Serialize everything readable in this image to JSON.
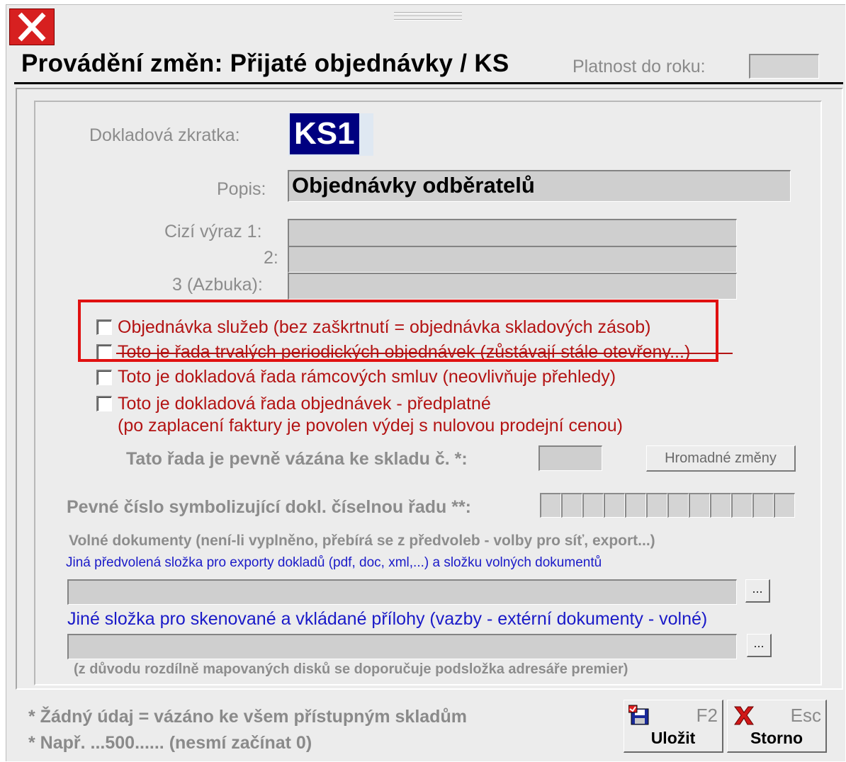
{
  "window": {
    "title": "Provádění změn: Přijaté objednávky / KS",
    "platnost_label": "Platnost do roku:",
    "platnost_value": ""
  },
  "form": {
    "dokladova_zkratka_label": "Dokladová zkratka:",
    "dokladova_zkratka_value": "KS1",
    "popis_label": "Popis:",
    "popis_value": "Objednávky odběratelů",
    "cizi_vyraz_1_label": "Cizí výraz 1:",
    "cizi_vyraz_2_label": "2:",
    "cizi_vyraz_3_label": "3 (Azbuka):",
    "cizi_vyraz_1_value": "",
    "cizi_vyraz_2_value": "",
    "cizi_vyraz_3_value": ""
  },
  "checkboxes": [
    {
      "label": "Objednávka služeb (bez zaškrtnutí = objednávka skladových zásob)",
      "checked": false
    },
    {
      "label": "Toto je řada trvalých periodických objednávek (zůstávají stále otevřeny...)",
      "checked": false
    },
    {
      "label": "Toto je dokladová řada rámcových smluv (neovlivňuje přehledy)",
      "checked": false
    },
    {
      "label": "Toto je dokladová řada objednávek - předplatné",
      "label_line2": "(po zaplacení faktury je povolen výdej s nulovou prodejní cenou)",
      "checked": false
    }
  ],
  "sklad": {
    "label": "Tato řada je pevně vázána ke skladu č. *:",
    "value": "",
    "hromadne_button": "Hromadné změny"
  },
  "pevne_cislo": {
    "label": "Pevné číslo symbolizující dokl. číselnou řadu **:",
    "segments": [
      "",
      "",
      "",
      "",
      "",
      "",
      "",
      "",
      "",
      "",
      "",
      ""
    ]
  },
  "volne": {
    "label": "Volné dokumenty (není-li vyplněno, přebírá se z předvoleb - volby pro síť, export...)",
    "export_label": "Jiná předvolená složka pro exporty dokladů (pdf, doc, xml,...) a složku volných dokumentů",
    "export_value": "",
    "browse_label": "...",
    "skeny_label": "Jiné složka pro skenované a vkládané přílohy (vazby - extérní dokumenty - volné)",
    "skeny_value": "",
    "note": "(z důvodu rozdílně mapovaných disků se doporučuje podsložka adresáře premier)"
  },
  "footer": {
    "note1": "* Žádný údaj = vázáno ke všem přístupným skladům",
    "note2": "* Např. ...500...... (nesmí začínat 0)",
    "save_key": "F2",
    "save_label": "Uložit",
    "cancel_key": "Esc",
    "cancel_label": "Storno"
  },
  "colors": {
    "highlight_box": "#e01010",
    "checkbox_text": "#b31313",
    "link_text": "#1a1ac8",
    "selection": "#000080"
  }
}
